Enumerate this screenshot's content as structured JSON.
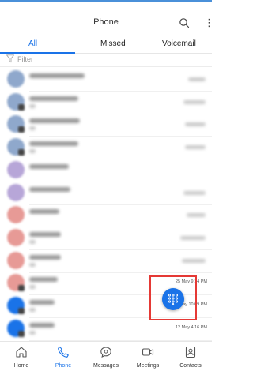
{
  "app": {
    "title": "Phone"
  },
  "header": {
    "search_icon": "search-icon",
    "more_icon": "more-vertical-icon",
    "more_glyph": "⋮"
  },
  "tabs": [
    {
      "label": "All",
      "active": true
    },
    {
      "label": "Missed",
      "active": false
    },
    {
      "label": "Voicemail",
      "active": false
    }
  ],
  "filter": {
    "placeholder": "Filter",
    "icon": "filter-icon"
  },
  "calls": [
    {
      "avatar_color": "#8fa8cc",
      "time": "",
      "badge": false
    },
    {
      "avatar_color": "#8fa8cc",
      "time": "",
      "badge": true
    },
    {
      "avatar_color": "#8fa8cc",
      "time": "",
      "badge": true
    },
    {
      "avatar_color": "#8fa8cc",
      "time": "",
      "badge": true
    },
    {
      "avatar_color": "#b7a6d8",
      "time": "",
      "badge": false
    },
    {
      "avatar_color": "#b7a6d8",
      "time": "",
      "badge": false
    },
    {
      "avatar_color": "#e79a96",
      "time": "",
      "badge": false
    },
    {
      "avatar_color": "#e79a96",
      "time": "",
      "badge": false
    },
    {
      "avatar_color": "#e79a96",
      "time": "",
      "badge": false
    },
    {
      "avatar_color": "#e79a96",
      "time": "25 May 9:14 PM",
      "badge": true
    },
    {
      "avatar_color": "#1a73e8",
      "time": "23 May 10:09 PM",
      "badge": true
    },
    {
      "avatar_color": "#1a73e8",
      "time": "12 May 4:16 PM",
      "badge": true
    }
  ],
  "fab": {
    "icon": "dialpad-icon"
  },
  "bottom_nav": [
    {
      "label": "Home",
      "icon": "home-icon",
      "active": false
    },
    {
      "label": "Phone",
      "icon": "phone-icon",
      "active": true
    },
    {
      "label": "Messages",
      "icon": "messages-icon",
      "active": false
    },
    {
      "label": "Meetings",
      "icon": "meetings-icon",
      "active": false
    },
    {
      "label": "Contacts",
      "icon": "contacts-icon",
      "active": false
    }
  ],
  "colors": {
    "accent": "#1a73e8",
    "highlight": "#e53935"
  }
}
